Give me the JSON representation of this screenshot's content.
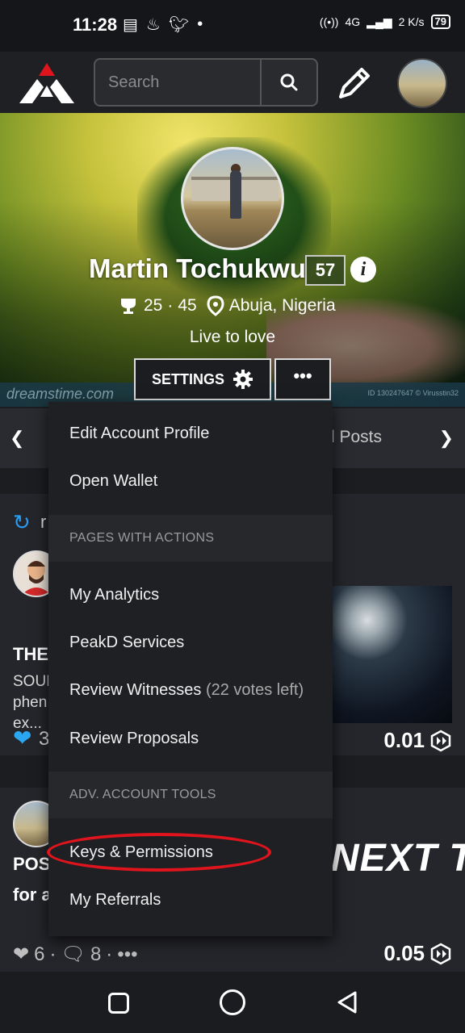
{
  "status_bar": {
    "time": "11:28",
    "network": "4G",
    "speed": "2 K/s",
    "battery": "79"
  },
  "topnav": {
    "search_placeholder": "Search"
  },
  "profile": {
    "name": "Martin Tochukwu",
    "reputation": "57",
    "followers": "25",
    "separator": "·",
    "following": "45",
    "location": "Abuja, Nigeria",
    "tagline": "Live to love",
    "settings_label": "SETTINGS",
    "more_label": "•••",
    "watermark": "dreamstime.com",
    "watermark_id": "ID 130247647 © Virusstin32"
  },
  "tabs": {
    "visible_label": "l Posts"
  },
  "feed": {
    "card1": {
      "reblog_prefix": "r",
      "title": "THE",
      "snippet_lines": [
        "SOUI",
        "phen",
        "ex..."
      ],
      "votes": "3",
      "payout": "0.01"
    },
    "card2": {
      "title_line1": "POS",
      "title_line2": "for a",
      "image_text": "NEXT T",
      "votes": "6",
      "comments": "8",
      "more": "•••",
      "payout": "0.05"
    }
  },
  "menu": {
    "edit_profile": "Edit Account Profile",
    "open_wallet": "Open Wallet",
    "section_pages": "PAGES WITH ACTIONS",
    "my_analytics": "My Analytics",
    "peakd_services": "PeakD Services",
    "review_witnesses": "Review Witnesses",
    "votes_left": "(22 votes left)",
    "review_proposals": "Review Proposals",
    "section_adv": "ADV. ACCOUNT TOOLS",
    "keys_permissions": "Keys & Permissions",
    "my_referrals": "My Referrals"
  },
  "colors": {
    "accent_red": "#e0141c",
    "reblog_blue": "#2a9df4",
    "heart_blue": "#2aa7f0",
    "background": "#1c1d21"
  }
}
